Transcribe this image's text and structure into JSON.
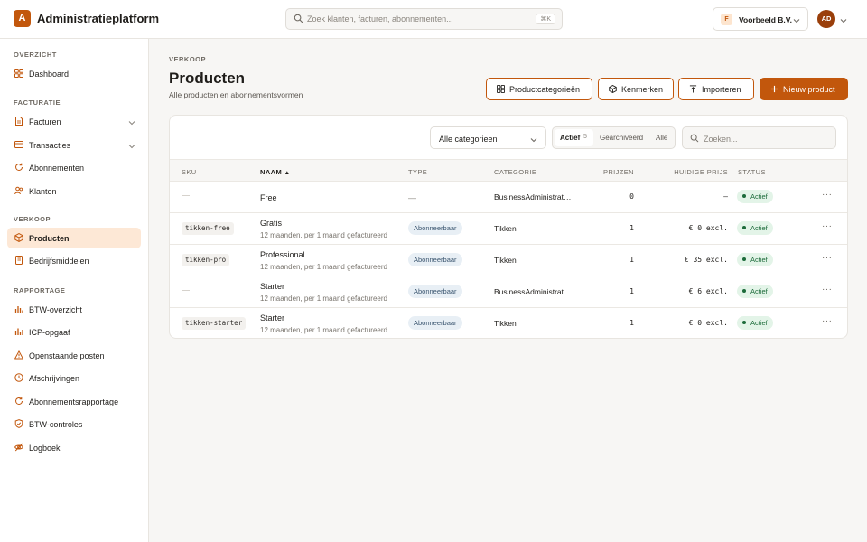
{
  "app": {
    "logo_letter": "A",
    "title": "Administratieplatform"
  },
  "search": {
    "placeholder": "Zoek klanten, facturen, abonnementen...",
    "shortcut": "⌘K"
  },
  "org": {
    "initial": "F",
    "name": "Voorbeeld B.V."
  },
  "user": {
    "initials": "AD"
  },
  "sidebar": {
    "sections": [
      {
        "title": "OVERZICHT",
        "items": [
          {
            "label": "Dashboard",
            "icon": "grid-icon"
          }
        ]
      },
      {
        "title": "FACTURATIE",
        "items": [
          {
            "label": "Facturen",
            "icon": "document-icon",
            "expandable": true
          },
          {
            "label": "Transacties",
            "icon": "card-icon",
            "expandable": true
          },
          {
            "label": "Abonnementen",
            "icon": "refresh-icon"
          },
          {
            "label": "Klanten",
            "icon": "users-icon"
          }
        ]
      },
      {
        "title": "VERKOOP",
        "items": [
          {
            "label": "Producten",
            "icon": "box-icon",
            "active": true
          },
          {
            "label": "Bedrijfsmiddelen",
            "icon": "book-icon"
          }
        ]
      },
      {
        "title": "RAPPORTAGE",
        "items": [
          {
            "label": "BTW-overzicht",
            "icon": "bar-chart-icon"
          },
          {
            "label": "ICP-opgaaf",
            "icon": "bar-chart-icon"
          },
          {
            "label": "Openstaande posten",
            "icon": "warning-icon"
          },
          {
            "label": "Afschrijvingen",
            "icon": "clock-icon"
          },
          {
            "label": "Abonnementsrapportage",
            "icon": "refresh-icon"
          },
          {
            "label": "BTW-controles",
            "icon": "shield-icon"
          },
          {
            "label": "Logboek",
            "icon": "eye-off-icon"
          }
        ]
      }
    ]
  },
  "page": {
    "breadcrumb": "VERKOOP",
    "title": "Producten",
    "subtitle": "Alle producten en abonnementsvormen"
  },
  "actions": {
    "categories": "Productcategorieën",
    "features": "Kenmerken",
    "import": "Importeren",
    "new_product": "Nieuw product"
  },
  "filters": {
    "category_select": "Alle categorieen",
    "segments": {
      "active": "Actief",
      "active_count": "5",
      "archived": "Gearchiveerd",
      "all": "Alle"
    },
    "search_placeholder": "Zoeken..."
  },
  "table": {
    "headers": {
      "sku": "SKU",
      "name": "NAAM",
      "sort_indicator": "▲",
      "type": "TYPE",
      "category": "CATEGORIE",
      "prices": "PRIJZEN",
      "current_price": "HUIDIGE PRIJS",
      "status": "STATUS"
    },
    "rows": [
      {
        "sku": "",
        "name": "Free",
        "desc": "",
        "type": "—",
        "category": "BusinessAdministrat…",
        "prices": "0",
        "price": "—",
        "status": "Actief"
      },
      {
        "sku": "tikken-free",
        "name": "Gratis",
        "desc": "12 maanden, per 1 maand gefactureerd",
        "type": "Abonneerbaar",
        "category": "Tikken",
        "prices": "1",
        "price": "€ 0 excl.",
        "status": "Actief"
      },
      {
        "sku": "tikken-pro",
        "name": "Professional",
        "desc": "12 maanden, per 1 maand gefactureerd",
        "type": "Abonneerbaar",
        "category": "Tikken",
        "prices": "1",
        "price": "€ 35 excl.",
        "status": "Actief"
      },
      {
        "sku": "",
        "name": "Starter",
        "desc": "12 maanden, per 1 maand gefactureerd",
        "type": "Abonneerbaar",
        "category": "BusinessAdministrat…",
        "prices": "1",
        "price": "€ 6 excl.",
        "status": "Actief"
      },
      {
        "sku": "tikken-starter",
        "name": "Starter",
        "desc": "12 maanden, per 1 maand gefactureerd",
        "type": "Abonneerbaar",
        "category": "Tikken",
        "prices": "1",
        "price": "€ 0 excl.",
        "status": "Actief"
      }
    ],
    "more_glyph": "···"
  },
  "colors": {
    "accent": "#c2570c",
    "active_bg": "#fde8d6",
    "status_bg": "#e3f4e8",
    "status_fg": "#1c6b3a",
    "type_bg": "#e8eff5"
  }
}
